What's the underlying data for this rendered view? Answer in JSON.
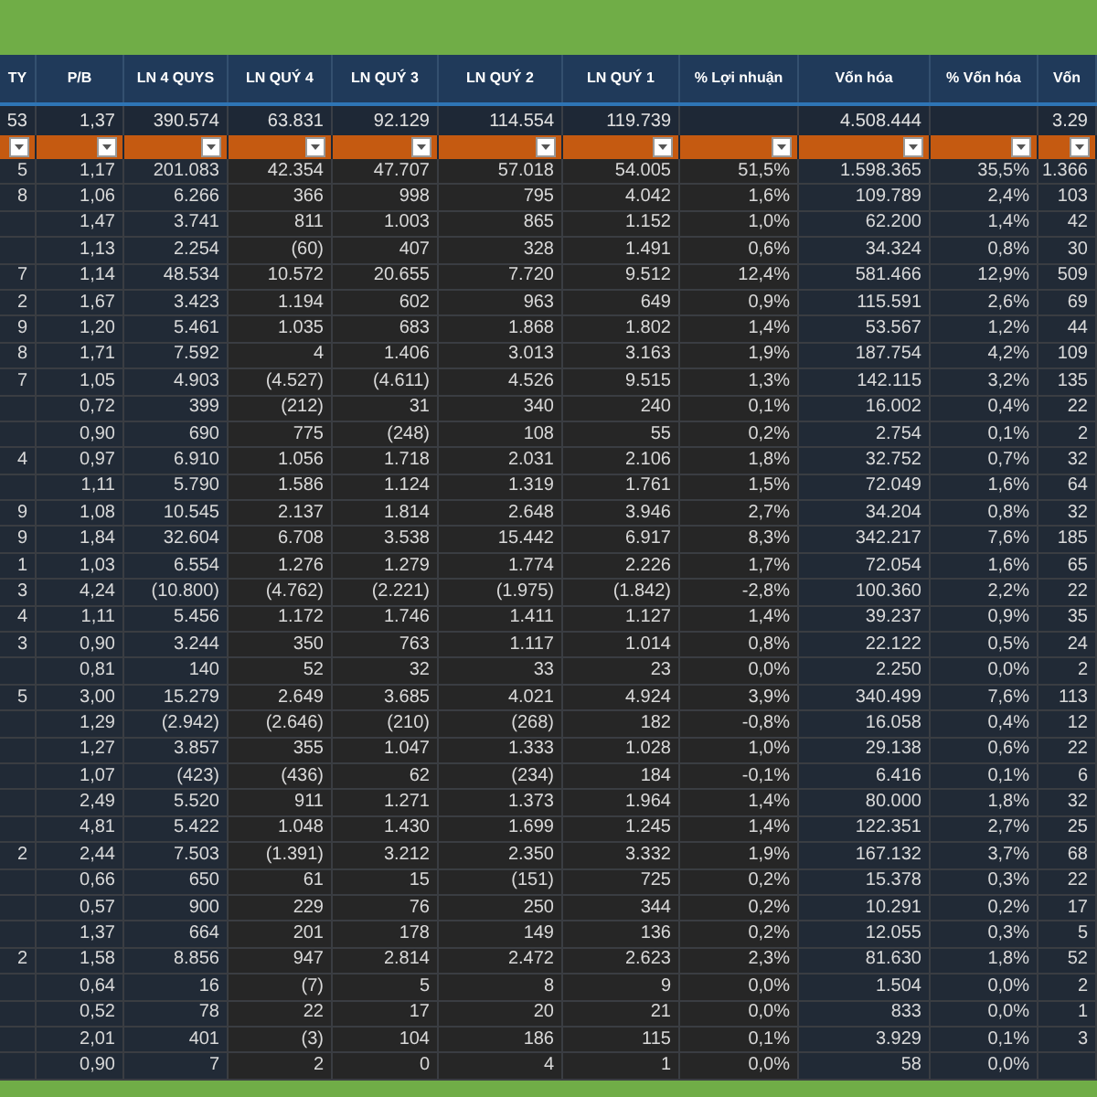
{
  "columns": [
    {
      "label": "TY",
      "total": "53"
    },
    {
      "label": "P/B",
      "total": "1,37"
    },
    {
      "label": "LN 4 QUYS",
      "total": "390.574"
    },
    {
      "label": "LN QUÝ 4",
      "total": "63.831"
    },
    {
      "label": "LN QUÝ 3",
      "total": "92.129"
    },
    {
      "label": "LN QUÝ 2",
      "total": "114.554"
    },
    {
      "label": "LN QUÝ 1",
      "total": "119.739"
    },
    {
      "label": "% Lợi nhuận"
    },
    {
      "label": "Vốn hóa",
      "total": "4.508.444"
    },
    {
      "label": "% Vốn hóa"
    },
    {
      "label": "Vốn",
      "total": "3.29"
    }
  ],
  "rows": [
    [
      "5",
      "1,17",
      "201.083",
      "42.354",
      "47.707",
      "57.018",
      "54.005",
      "51,5%",
      "1.598.365",
      "35,5%",
      "1.366"
    ],
    [
      "8",
      "1,06",
      "6.266",
      "366",
      "998",
      "795",
      "4.042",
      "1,6%",
      "109.789",
      "2,4%",
      "103"
    ],
    [
      null,
      "1,47",
      "3.741",
      "811",
      "1.003",
      "865",
      "1.152",
      "1,0%",
      "62.200",
      "1,4%",
      "42"
    ],
    [
      null,
      "1,13",
      "2.254",
      "(60)",
      "407",
      "328",
      "1.491",
      "0,6%",
      "34.324",
      "0,8%",
      "30"
    ],
    [
      "7",
      "1,14",
      "48.534",
      "10.572",
      "20.655",
      "7.720",
      "9.512",
      "12,4%",
      "581.466",
      "12,9%",
      "509"
    ],
    [
      "2",
      "1,67",
      "3.423",
      "1.194",
      "602",
      "963",
      "649",
      "0,9%",
      "115.591",
      "2,6%",
      "69"
    ],
    [
      "9",
      "1,20",
      "5.461",
      "1.035",
      "683",
      "1.868",
      "1.802",
      "1,4%",
      "53.567",
      "1,2%",
      "44"
    ],
    [
      "8",
      "1,71",
      "7.592",
      "4",
      "1.406",
      "3.013",
      "3.163",
      "1,9%",
      "187.754",
      "4,2%",
      "109"
    ],
    [
      "7",
      "1,05",
      "4.903",
      "(4.527)",
      "(4.611)",
      "4.526",
      "9.515",
      "1,3%",
      "142.115",
      "3,2%",
      "135"
    ],
    [
      null,
      "0,72",
      "399",
      "(212)",
      "31",
      "340",
      "240",
      "0,1%",
      "16.002",
      "0,4%",
      "22"
    ],
    [
      null,
      "0,90",
      "690",
      "775",
      "(248)",
      "108",
      "55",
      "0,2%",
      "2.754",
      "0,1%",
      "2"
    ],
    [
      "4",
      "0,97",
      "6.910",
      "1.056",
      "1.718",
      "2.031",
      "2.106",
      "1,8%",
      "32.752",
      "0,7%",
      "32"
    ],
    [
      null,
      "1,11",
      "5.790",
      "1.586",
      "1.124",
      "1.319",
      "1.761",
      "1,5%",
      "72.049",
      "1,6%",
      "64"
    ],
    [
      "9",
      "1,08",
      "10.545",
      "2.137",
      "1.814",
      "2.648",
      "3.946",
      "2,7%",
      "34.204",
      "0,8%",
      "32"
    ],
    [
      "9",
      "1,84",
      "32.604",
      "6.708",
      "3.538",
      "15.442",
      "6.917",
      "8,3%",
      "342.217",
      "7,6%",
      "185"
    ],
    [
      "1",
      "1,03",
      "6.554",
      "1.276",
      "1.279",
      "1.774",
      "2.226",
      "1,7%",
      "72.054",
      "1,6%",
      "65"
    ],
    [
      "3",
      "4,24",
      "(10.800)",
      "(4.762)",
      "(2.221)",
      "(1.975)",
      "(1.842)",
      "-2,8%",
      "100.360",
      "2,2%",
      "22"
    ],
    [
      "4",
      "1,11",
      "5.456",
      "1.172",
      "1.746",
      "1.411",
      "1.127",
      "1,4%",
      "39.237",
      "0,9%",
      "35"
    ],
    [
      "3",
      "0,90",
      "3.244",
      "350",
      "763",
      "1.117",
      "1.014",
      "0,8%",
      "22.122",
      "0,5%",
      "24"
    ],
    [
      null,
      "0,81",
      "140",
      "52",
      "32",
      "33",
      "23",
      "0,0%",
      "2.250",
      "0,0%",
      "2"
    ],
    [
      "5",
      "3,00",
      "15.279",
      "2.649",
      "3.685",
      "4.021",
      "4.924",
      "3,9%",
      "340.499",
      "7,6%",
      "113"
    ],
    [
      null,
      "1,29",
      "(2.942)",
      "(2.646)",
      "(210)",
      "(268)",
      "182",
      "-0,8%",
      "16.058",
      "0,4%",
      "12"
    ],
    [
      null,
      "1,27",
      "3.857",
      "355",
      "1.047",
      "1.333",
      "1.028",
      "1,0%",
      "29.138",
      "0,6%",
      "22"
    ],
    [
      null,
      "1,07",
      "(423)",
      "(436)",
      "62",
      "(234)",
      "184",
      "-0,1%",
      "6.416",
      "0,1%",
      "6"
    ],
    [
      null,
      "2,49",
      "5.520",
      "911",
      "1.271",
      "1.373",
      "1.964",
      "1,4%",
      "80.000",
      "1,8%",
      "32"
    ],
    [
      null,
      "4,81",
      "5.422",
      "1.048",
      "1.430",
      "1.699",
      "1.245",
      "1,4%",
      "122.351",
      "2,7%",
      "25"
    ],
    [
      "2",
      "2,44",
      "7.503",
      "(1.391)",
      "3.212",
      "2.350",
      "3.332",
      "1,9%",
      "167.132",
      "3,7%",
      "68"
    ],
    [
      null,
      "0,66",
      "650",
      "61",
      "15",
      "(151)",
      "725",
      "0,2%",
      "15.378",
      "0,3%",
      "22"
    ],
    [
      null,
      "0,57",
      "900",
      "229",
      "76",
      "250",
      "344",
      "0,2%",
      "10.291",
      "0,2%",
      "17"
    ],
    [
      null,
      "1,37",
      "664",
      "201",
      "178",
      "149",
      "136",
      "0,2%",
      "12.055",
      "0,3%",
      "5"
    ],
    [
      "2",
      "1,58",
      "8.856",
      "947",
      "2.814",
      "2.472",
      "2.623",
      "2,3%",
      "81.630",
      "1,8%",
      "52"
    ],
    [
      null,
      "0,64",
      "16",
      "(7)",
      "5",
      "8",
      "9",
      "0,0%",
      "1.504",
      "0,0%",
      "2"
    ],
    [
      null,
      "0,52",
      "78",
      "22",
      "17",
      "20",
      "21",
      "0,0%",
      "833",
      "0,0%",
      "1"
    ],
    [
      null,
      "2,01",
      "401",
      "(3)",
      "104",
      "186",
      "115",
      "0,1%",
      "3.929",
      "0,1%",
      "3"
    ],
    [
      null,
      "0,90",
      "7",
      "2",
      "0",
      "4",
      "1",
      "0,0%",
      "58",
      "0,0%",
      null
    ]
  ]
}
